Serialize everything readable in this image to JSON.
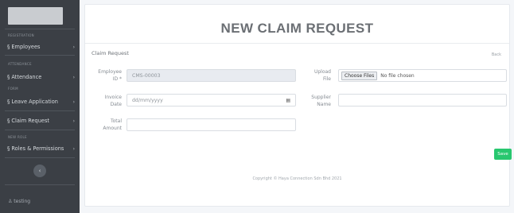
{
  "sidebar": {
    "sections": [
      {
        "label": "REGISTRATION"
      },
      {
        "label": "ATTENDANCE"
      },
      {
        "label": "FORM"
      },
      {
        "label": "NEW ROLE"
      }
    ],
    "items": [
      {
        "label": "§ Employees"
      },
      {
        "label": "§ Attendance"
      },
      {
        "label": "§ Leave Application"
      },
      {
        "label": "§ Claim Request"
      },
      {
        "label": "§ Roles & Permissions"
      }
    ],
    "chevron": "›",
    "collapse_icon": "‹",
    "user": "♙ testing"
  },
  "page": {
    "title": "NEW CLAIM REQUEST",
    "breadcrumb": "Claim Request",
    "back_label": "Back"
  },
  "form": {
    "employee_id": {
      "label_line1": "Employee",
      "label_line2": "ID *",
      "value": "CMS-00003"
    },
    "invoice_date": {
      "label_line1": "Invoice",
      "label_line2": "Date",
      "placeholder": "dd/mm/yyyy"
    },
    "total_amount": {
      "label_line1": "Total",
      "label_line2": "Amount",
      "value": ""
    },
    "upload_file": {
      "label_line1": "Upload",
      "label_line2": "File",
      "button_label": "Choose Files",
      "status": "No file chosen"
    },
    "supplier_name": {
      "label_line1": "Supplier",
      "label_line2": "Name",
      "value": ""
    },
    "save_label": "Save"
  },
  "footer": {
    "copyright": "Copyright © Haya Connection Sdn Bhd 2021"
  },
  "colors": {
    "sidebar_bg": "#3b3f45",
    "save_green": "#28c76f",
    "title_gray": "#6b6f74"
  }
}
